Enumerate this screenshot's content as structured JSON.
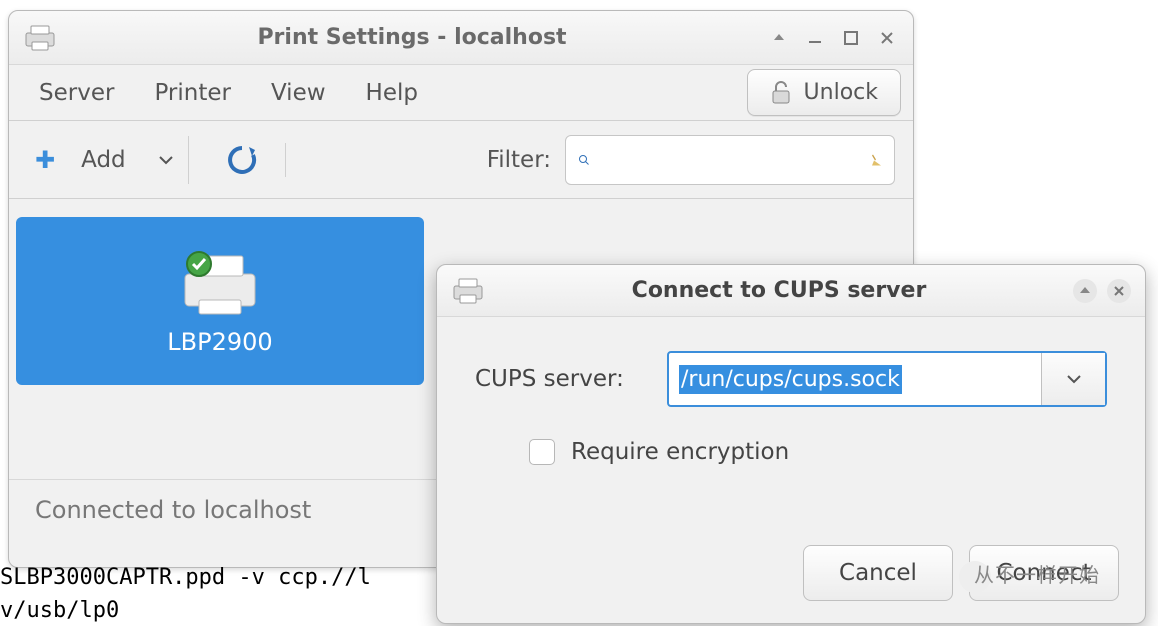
{
  "main": {
    "title": "Print Settings - localhost",
    "menu": {
      "server": "Server",
      "printer": "Printer",
      "view": "View",
      "help": "Help"
    },
    "unlock": "Unlock",
    "toolbar": {
      "add": "Add",
      "filter_label": "Filter:",
      "filter_value": ""
    },
    "printer": {
      "name": "LBP2900"
    },
    "status": "Connected to localhost"
  },
  "dialog": {
    "title": "Connect to CUPS server",
    "server_label": "CUPS server:",
    "server_value": "/run/cups/cups.sock",
    "encrypt_label": "Require encryption",
    "cancel": "Cancel",
    "connect": "Connect"
  },
  "terminal": {
    "line1": "SLBP3000CAPTR.ppd -v ccp.//l",
    "line2": "v/usb/lp0"
  },
  "watermark": "从不一样开始"
}
